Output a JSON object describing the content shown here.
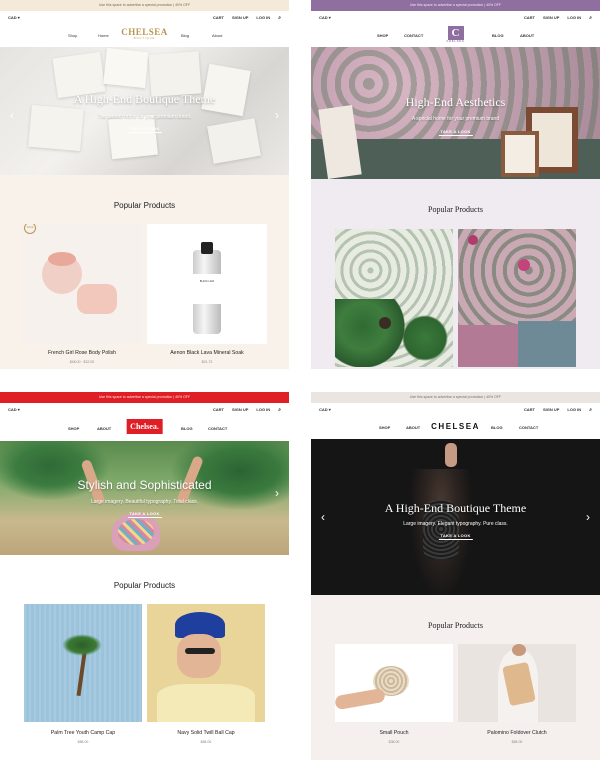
{
  "panels": [
    {
      "announcement": "Use this space to advertise a special promotion | 40% OFF",
      "currency": "CAD",
      "util": [
        "CART",
        "SIGN UP",
        "LOG IN"
      ],
      "nav": [
        "Shop",
        "Home",
        "Blog",
        "About"
      ],
      "logo": "CHELSEA",
      "logo_sub": "BOUTIQUE",
      "hero_title": "A High-End Boutique Theme",
      "hero_sub": "The perfect home for your premium brand.",
      "hero_button": "TAKE A LOOK",
      "section_title": "Popular Products",
      "badge": "SALE",
      "products": [
        {
          "name": "French Girl Rose Body Polish",
          "price": "$48.00 · $32.00"
        },
        {
          "name": "Aenon Black Lava Mineral Soak",
          "price": "$21.72"
        }
      ],
      "jar_label": "BLACK LAVA"
    },
    {
      "announcement": "Use this space to advertise a special promotion | 40% OFF",
      "currency": "CAD",
      "util": [
        "CART",
        "SIGN UP",
        "LOG IN"
      ],
      "nav": [
        "SHOP",
        "CONTACT",
        "BLOG",
        "ABOUT"
      ],
      "logo": "C",
      "logo_sub": "CHELSEA",
      "hero_title": "High-End Aesthetics",
      "hero_sub": "A special home for your premium brand",
      "hero_button": "TAKE A LOOK",
      "section_title": "Popular Products",
      "products": []
    },
    {
      "announcement": "Use this space to advertise a special promotion | 40% OFF",
      "currency": "CAD",
      "util": [
        "CART",
        "SIGN UP",
        "LOG IN"
      ],
      "nav": [
        "SHOP",
        "ABOUT",
        "BLOG",
        "CONTACT"
      ],
      "logo": "Chelsea.",
      "hero_title": "Stylish and Sophisticated",
      "hero_sub": "Large imagery. Beautiful typography. Total class.",
      "hero_button": "TAKE A LOOK",
      "section_title": "Popular Products",
      "products": [
        {
          "name": "Palm Tree Youth Camp Cap",
          "price": "$88.00"
        },
        {
          "name": "Navy Solid Twill Ball Cap",
          "price": "$68.00"
        }
      ]
    },
    {
      "announcement": "Use this space to advertise a special promotion | 40% OFF",
      "currency": "CAD",
      "util": [
        "CART",
        "SIGN UP",
        "LOG IN"
      ],
      "nav": [
        "SHOP",
        "ABOUT",
        "BLOG",
        "CONTACT"
      ],
      "logo": "CHELSEA",
      "hero_title": "A High-End Boutique Theme",
      "hero_sub": "Large imagery. Elegant typography. Pure class.",
      "hero_button": "TAKE A LOOK",
      "section_title": "Popular Products",
      "products": [
        {
          "name": "Small Pouch",
          "price": "$38.00"
        },
        {
          "name": "Palomino Foldover Clutch",
          "price": "$85.00"
        }
      ]
    }
  ],
  "icons": {
    "search": "search-icon",
    "chevron": "chevron-down-icon",
    "prev": "chevron-left-icon",
    "next": "chevron-right-icon"
  },
  "colors": {
    "cream": "#f8f2ea",
    "gold": "#b8964f",
    "lavender": "#8e6fa0",
    "red": "#e01e26",
    "dark": "#151515"
  }
}
